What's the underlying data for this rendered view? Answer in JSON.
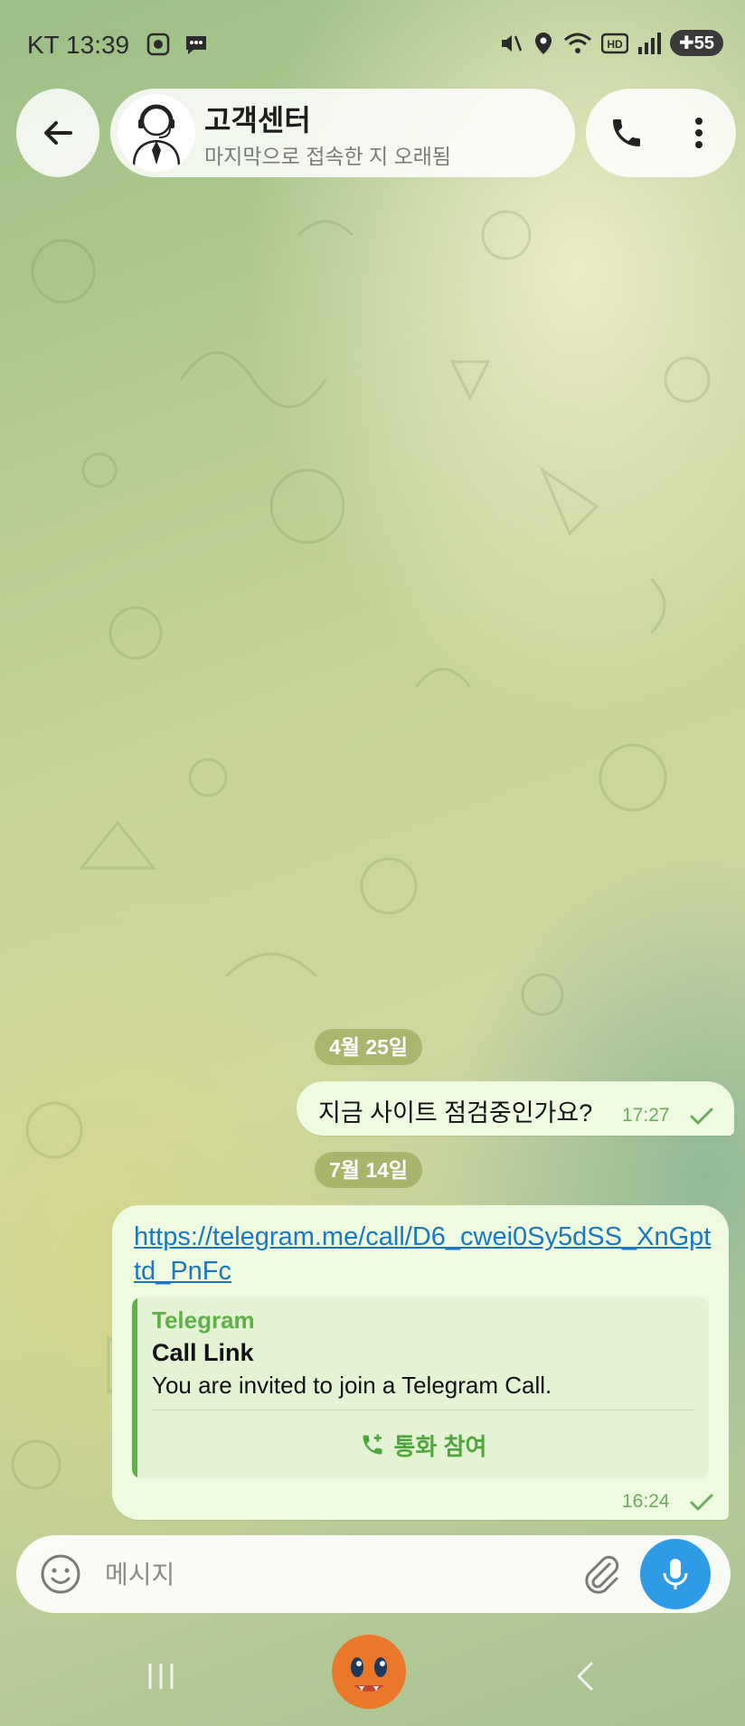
{
  "status_bar": {
    "carrier_time": "KT 13:39",
    "battery": "55"
  },
  "header": {
    "title": "고객센터",
    "subtitle": "마지막으로 접속한 지 오래됨"
  },
  "messages": [
    {
      "date_chip": "4월 25일",
      "text": "지금 사이트 점검중인가요?",
      "time": "17:27"
    },
    {
      "date_chip": "7월 14일",
      "link": "https://telegram.me/call/D6_cwei0Sy5dSS_XnGpttd_PnFc",
      "preview": {
        "site": "Telegram",
        "title": "Call Link",
        "description": "You are invited to join a Telegram Call.",
        "button": "통화 참여"
      },
      "time": "16:24"
    }
  ],
  "input": {
    "placeholder": "메시지"
  },
  "colors": {
    "accent_green": "#5fb04a",
    "link_blue": "#1a78c2",
    "mic_blue": "#2f9be6",
    "bubble": "#eefbe0"
  }
}
